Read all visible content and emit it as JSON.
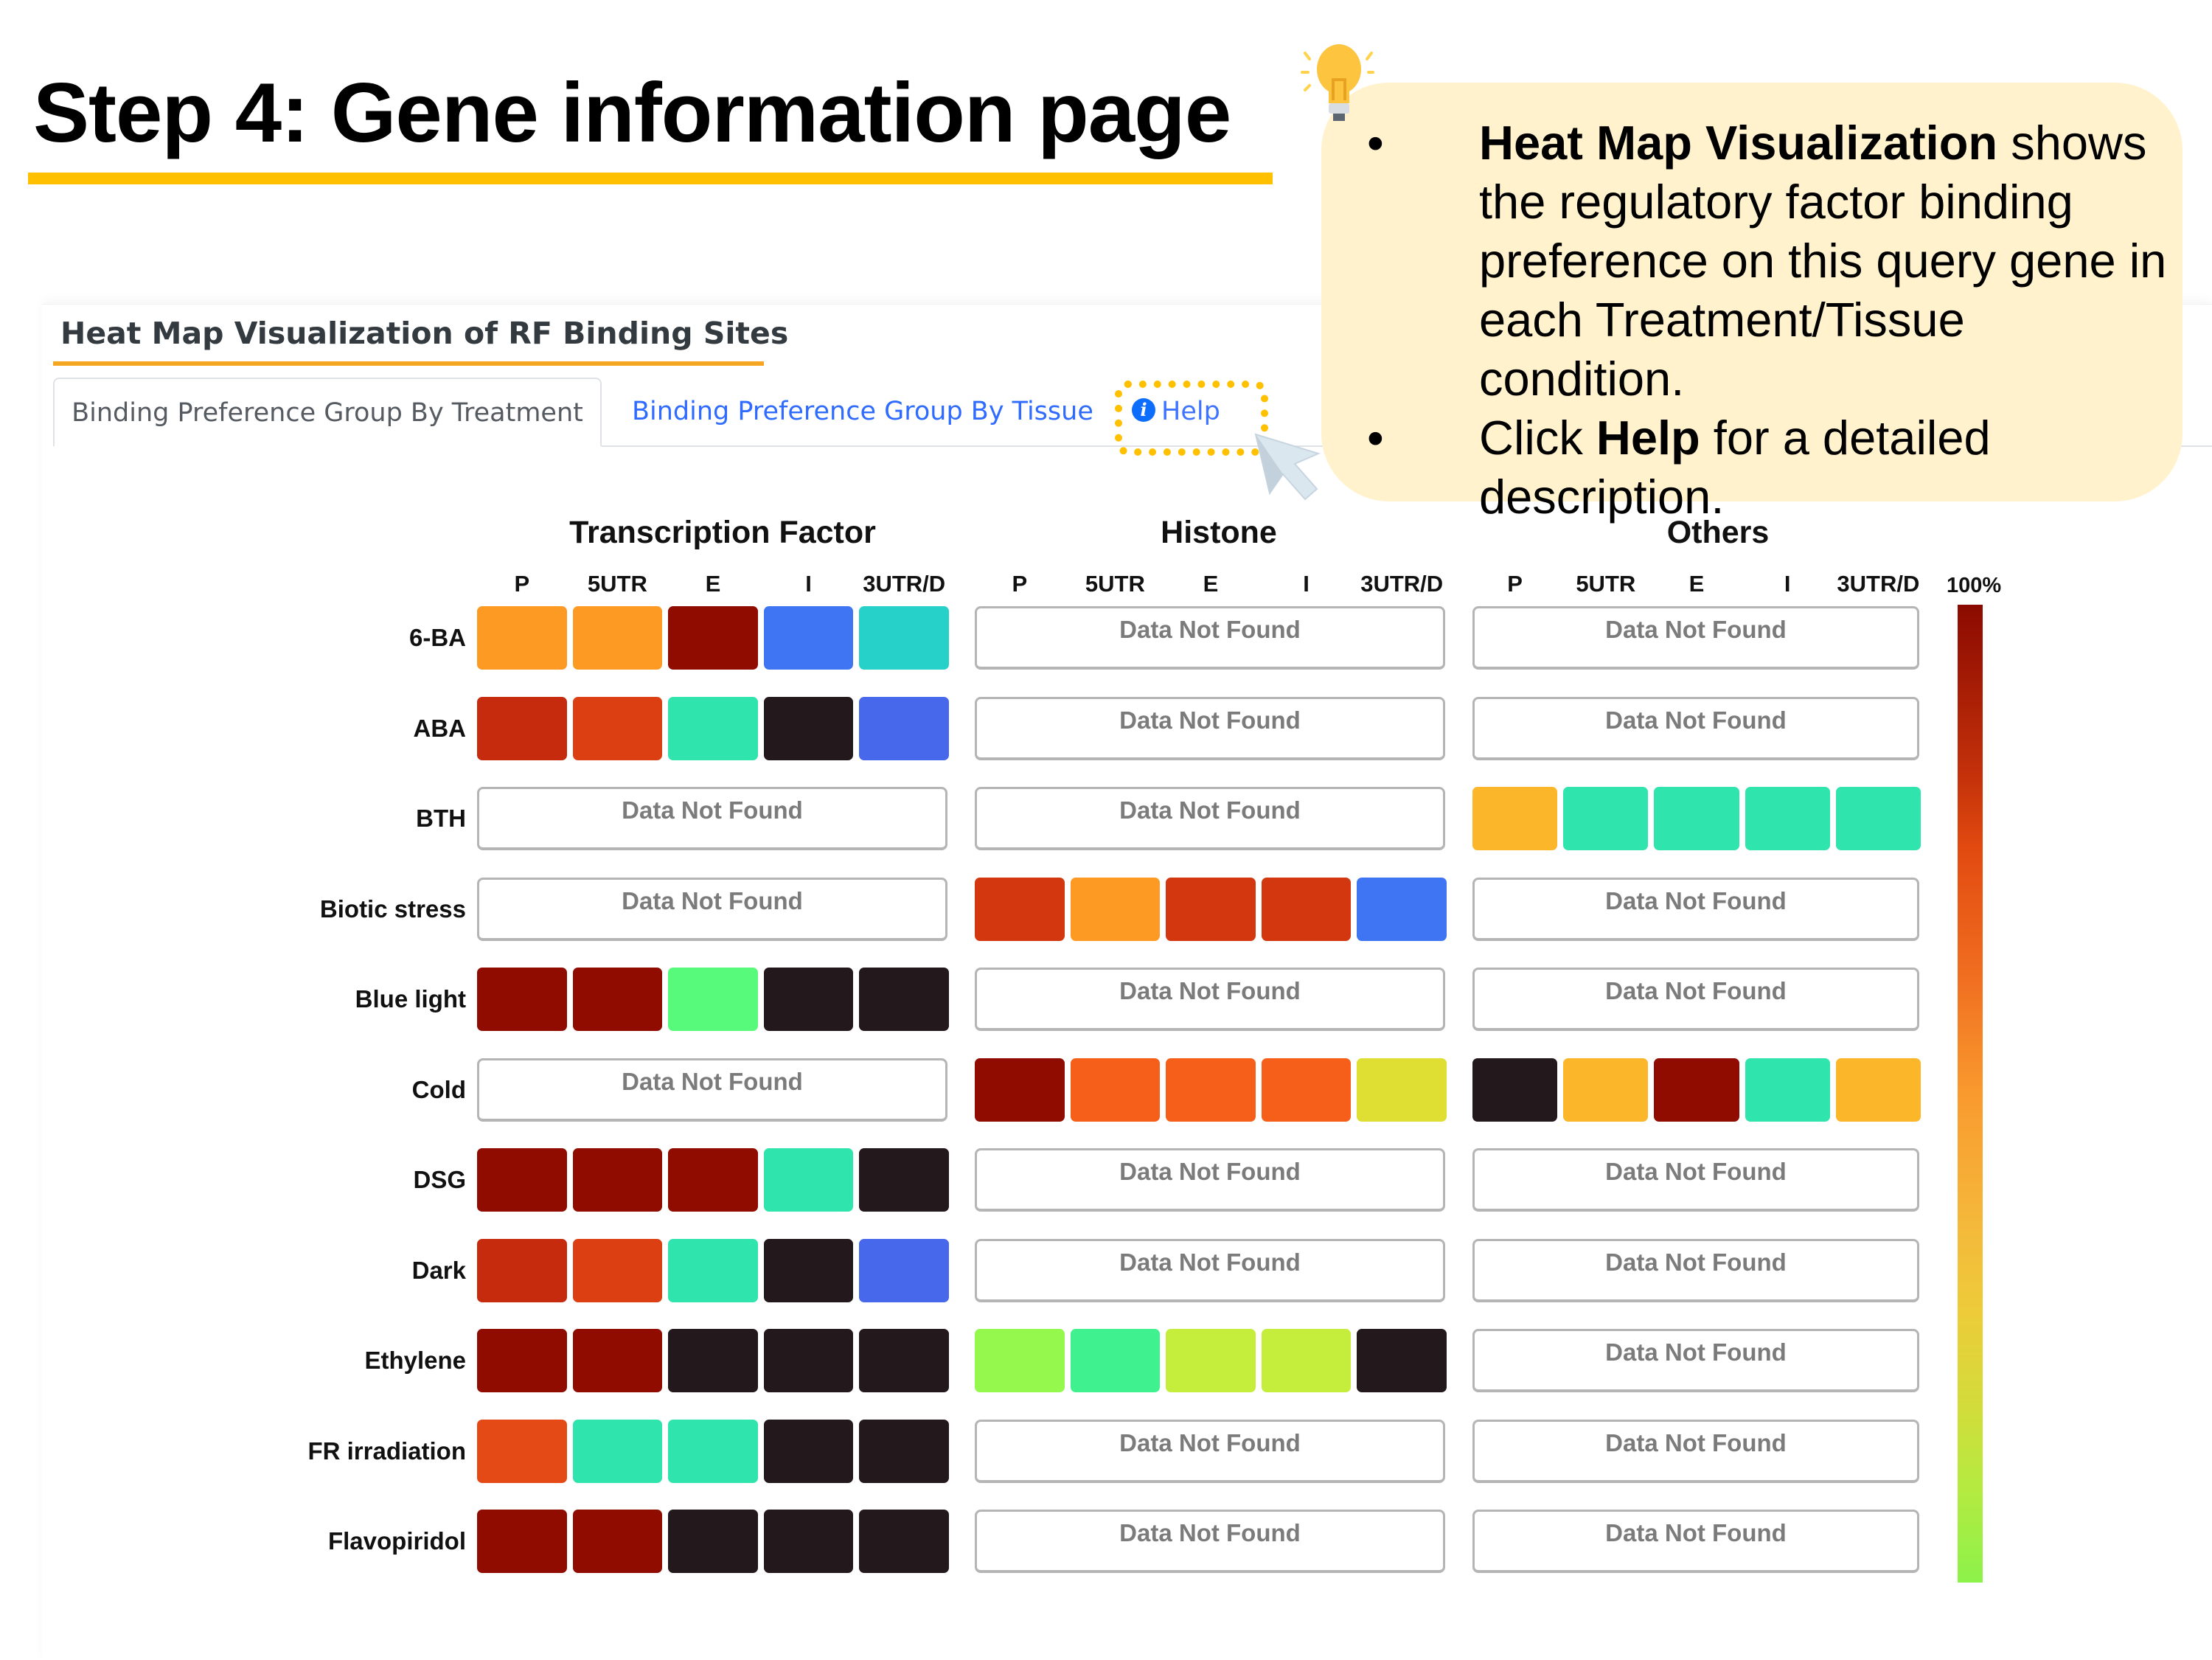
{
  "slide": {
    "title": "Step 4: Gene information page"
  },
  "callout": {
    "bullets": [
      {
        "bold": "Heat Map Visualization",
        "text": " shows the regulatory factor binding preference on this query gene in each Treatment/Tissue condition."
      },
      {
        "pre": "Click ",
        "bold": "Help",
        "text": " for a detailed description."
      }
    ],
    "bullet_char": "•",
    "icon": "lightbulb-icon"
  },
  "panel": {
    "heading": "Heat Map Visualization of RF Binding Sites",
    "tabs": [
      {
        "label": "Binding Preference Group By Treatment",
        "active": true
      },
      {
        "label": "Binding Preference Group By Tissue",
        "active": false
      }
    ],
    "help": {
      "label": "Help",
      "icon": "info-icon"
    }
  },
  "colors": {
    "accent_yellow": "#ffc000",
    "heading_underline": "#f5a623",
    "link_blue": "#2f6bff",
    "callout_bg": "#fff2cc"
  },
  "chart_data": {
    "type": "heatmap",
    "title": "Heat Map Visualization of RF Binding Sites",
    "groups": [
      "Transcription Factor",
      "Histone",
      "Others"
    ],
    "columns": [
      "P",
      "5UTR",
      "E",
      "I",
      "3UTR/D"
    ],
    "rows": [
      "6-BA",
      "ABA",
      "BTH",
      "Biotic stress",
      "Blue light",
      "Cold",
      "DSG",
      "Dark",
      "Ethylene",
      "FR irradiation",
      "Flavopiridol"
    ],
    "missing_label": "Data Not Found",
    "legend": {
      "label": "100%",
      "gradient_top": "#8b0a00",
      "gradient_bottom": "#8cf24a",
      "placement": "right"
    },
    "cells": {
      "Transcription Factor": [
        [
          "#fd9a24",
          "#fd9a24",
          "#900c00",
          "#3f75f2",
          "#26d1c9"
        ],
        [
          "#c62b0e",
          "#dc3f12",
          "#2fe4ad",
          "#23181b",
          "#4768ea"
        ],
        null,
        null,
        [
          "#900c00",
          "#900c00",
          "#57fa7a",
          "#23181b",
          "#23181b"
        ],
        null,
        [
          "#900c00",
          "#900c00",
          "#900c00",
          "#2fe4ad",
          "#23181b"
        ],
        [
          "#c62b0e",
          "#dc3f12",
          "#2fe4ad",
          "#23181b",
          "#4768ea"
        ],
        [
          "#900c00",
          "#900c00",
          "#23181b",
          "#23181b",
          "#23181b"
        ],
        [
          "#e44a15",
          "#2fe4ad",
          "#2fe4ad",
          "#23181b",
          "#23181b"
        ],
        [
          "#900c00",
          "#900c00",
          "#23181b",
          "#23181b",
          "#23181b"
        ]
      ],
      "Histone": [
        null,
        null,
        null,
        [
          "#d33710",
          "#fd9a24",
          "#d33710",
          "#d33710",
          "#3f75f2"
        ],
        null,
        [
          "#900c00",
          "#f65f1a",
          "#f65f1a",
          "#f65f1a",
          "#dede33"
        ],
        null,
        null,
        [
          "#95f84c",
          "#40f18f",
          "#c4ed3c",
          "#c4ed3c",
          "#23181b"
        ],
        null,
        null
      ],
      "Others": [
        null,
        null,
        [
          "#fcb62a",
          "#2fe4ad",
          "#2fe4ad",
          "#2fe4ad",
          "#2fe4ad"
        ],
        null,
        null,
        [
          "#23181b",
          "#fcb62a",
          "#900c00",
          "#2fe4ad",
          "#fcb62a"
        ],
        null,
        null,
        null,
        null,
        null
      ]
    }
  }
}
